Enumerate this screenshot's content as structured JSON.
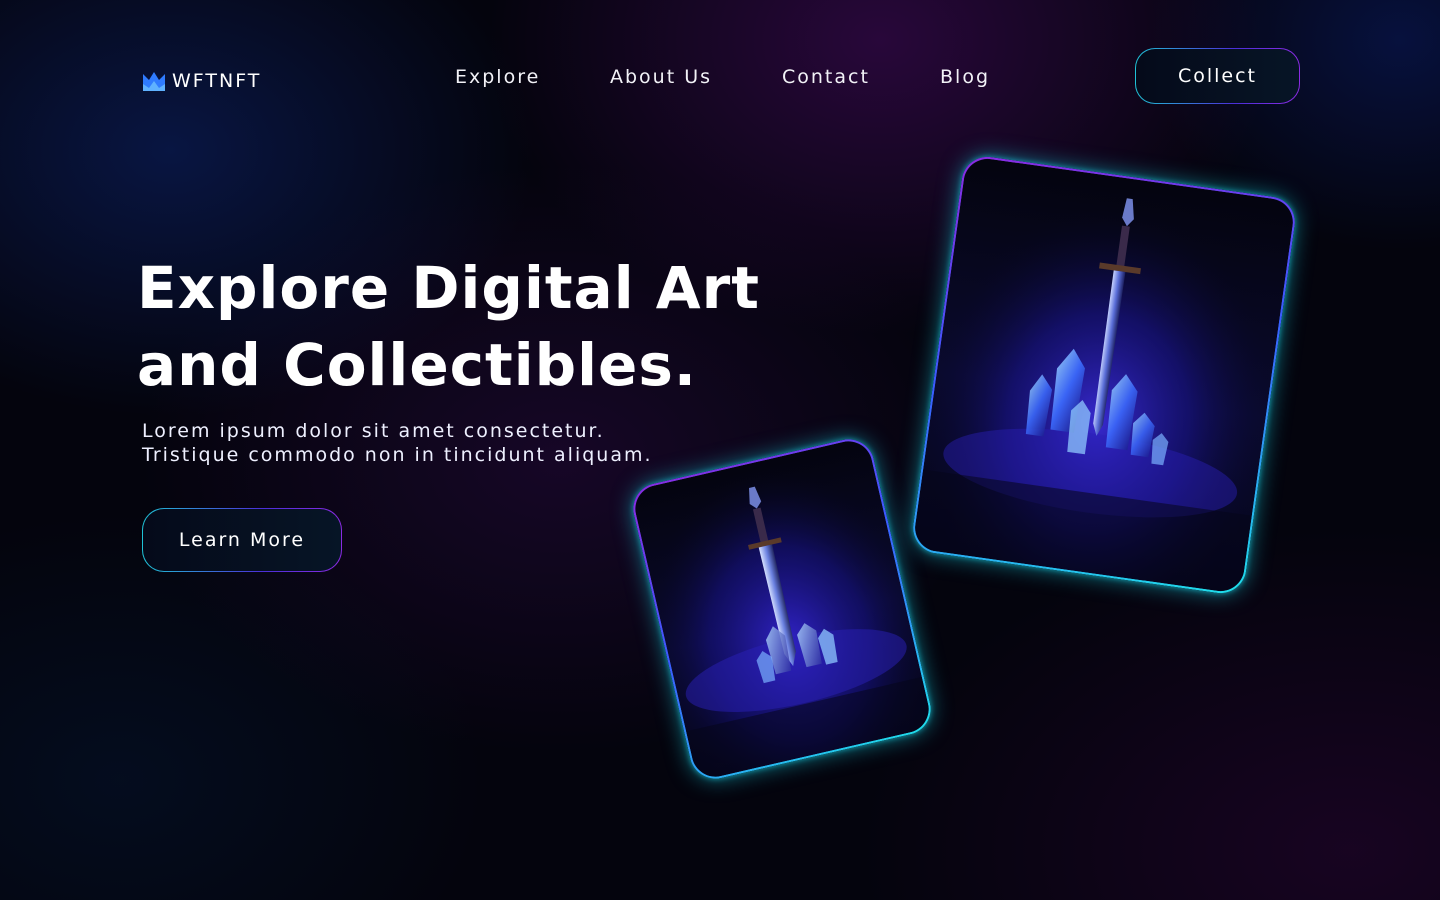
{
  "brand": {
    "name": "WFTNFT",
    "logo_icon": "crown-mountain-icon",
    "accent_color": "#2f7bff"
  },
  "nav": {
    "items": [
      {
        "label": "Explore"
      },
      {
        "label": "About Us"
      },
      {
        "label": "Contact"
      },
      {
        "label": "Blog"
      }
    ]
  },
  "header": {
    "cta_label": "Collect"
  },
  "hero": {
    "title_line1": "Explore Digital Art",
    "title_line2": "and Collectibles.",
    "subtitle_line1": "Lorem ipsum dolor sit amet consectetur.",
    "subtitle_line2": "Tristique commodo non in tincidunt aliquam.",
    "cta_label": "Learn More"
  },
  "cards": [
    {
      "art": "sword-in-crystals-art"
    },
    {
      "art": "sword-in-crystals-art"
    }
  ],
  "colors": {
    "glow": "#1fe0ea",
    "border_purple": "#8a2be2",
    "background": "#04040d"
  }
}
